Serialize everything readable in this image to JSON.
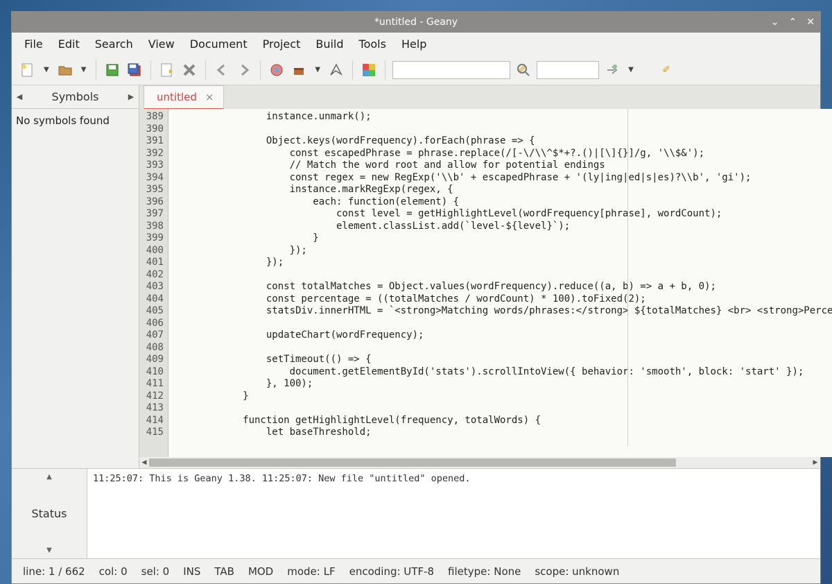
{
  "window": {
    "title": "*untitled - Geany"
  },
  "menubar": [
    "File",
    "Edit",
    "Search",
    "View",
    "Document",
    "Project",
    "Build",
    "Tools",
    "Help"
  ],
  "toolbar_icons": {
    "new": "new-file-icon",
    "open": "open-file-icon",
    "save": "save-icon",
    "saveall": "save-all-icon",
    "reload": "reload-icon",
    "close": "close-doc-icon",
    "back": "nav-back-icon",
    "forward": "nav-forward-icon",
    "compile": "compile-icon",
    "build": "build-icon",
    "run": "run-icon",
    "color": "color-picker-icon",
    "search": "search-icon",
    "goto": "goto-icon"
  },
  "sidebar": {
    "tab": "Symbols",
    "content": "No symbols found"
  },
  "doctab": {
    "label": "untitled"
  },
  "editor": {
    "first_line": 389,
    "lines": [
      "                instance.unmark();",
      "",
      "                Object.keys(wordFrequency).forEach(phrase => {",
      "                    const escapedPhrase = phrase.replace(/[-\\/\\\\^$*+?.()|[\\]{}]/g, '\\\\$&');",
      "                    // Match the word root and allow for potential endings",
      "                    const regex = new RegExp('\\\\b' + escapedPhrase + '(ly|ing|ed|s|es)?\\\\b', 'gi');",
      "                    instance.markRegExp(regex, {",
      "                        each: function(element) {",
      "                            const level = getHighlightLevel(wordFrequency[phrase], wordCount);",
      "                            element.classList.add(`level-${level}`);",
      "                        }",
      "                    });",
      "                });",
      "",
      "                const totalMatches = Object.values(wordFrequency).reduce((a, b) => a + b, 0);",
      "                const percentage = ((totalMatches / wordCount) * 100).toFixed(2);",
      "                statsDiv.innerHTML = `<strong>Matching words/phrases:</strong> ${totalMatches} <br> <strong>Perce",
      "",
      "                updateChart(wordFrequency);",
      "",
      "                setTimeout(() => {",
      "                    document.getElementById('stats').scrollIntoView({ behavior: 'smooth', block: 'start' });",
      "                }, 100);",
      "            }",
      "",
      "            function getHighlightLevel(frequency, totalWords) {",
      "                let baseThreshold;"
    ]
  },
  "messages": {
    "tab": "Status",
    "entries": [
      "11:25:07: This is Geany 1.38.",
      "11:25:07: New file \"untitled\" opened."
    ]
  },
  "statusbar": {
    "line": "line: 1 / 662",
    "col": "col: 0",
    "sel": "sel: 0",
    "ins": "INS",
    "tab": "TAB",
    "mod": "MOD",
    "mode": "mode: LF",
    "encoding": "encoding: UTF-8",
    "filetype": "filetype: None",
    "scope": "scope: unknown"
  }
}
